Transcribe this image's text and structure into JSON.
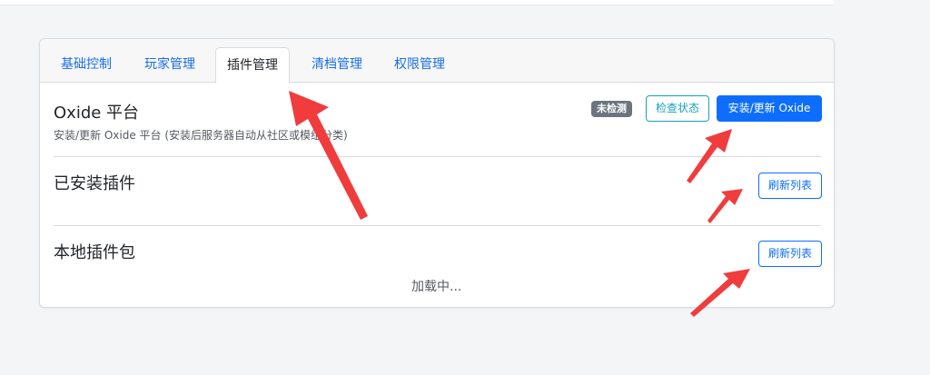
{
  "tabs": [
    {
      "label": "基础控制"
    },
    {
      "label": "玩家管理"
    },
    {
      "label": "插件管理"
    },
    {
      "label": "清档管理"
    },
    {
      "label": "权限管理"
    }
  ],
  "oxide": {
    "title": "Oxide 平台",
    "description": "安装/更新 Oxide 平台 (安装后服务器自动从社区或模组分类)",
    "status_badge": "未检测",
    "check_button": "检查状态",
    "install_button": "安装/更新 Oxide"
  },
  "installed": {
    "title": "已安装插件",
    "refresh_button": "刷新列表"
  },
  "local": {
    "title": "本地插件包",
    "refresh_button": "刷新列表",
    "loading_text": "加载中..."
  },
  "colors": {
    "accent": "#0d6efd",
    "info": "#17a2b8",
    "badge": "#6c757d",
    "annotation_arrow": "#f03c3c"
  }
}
